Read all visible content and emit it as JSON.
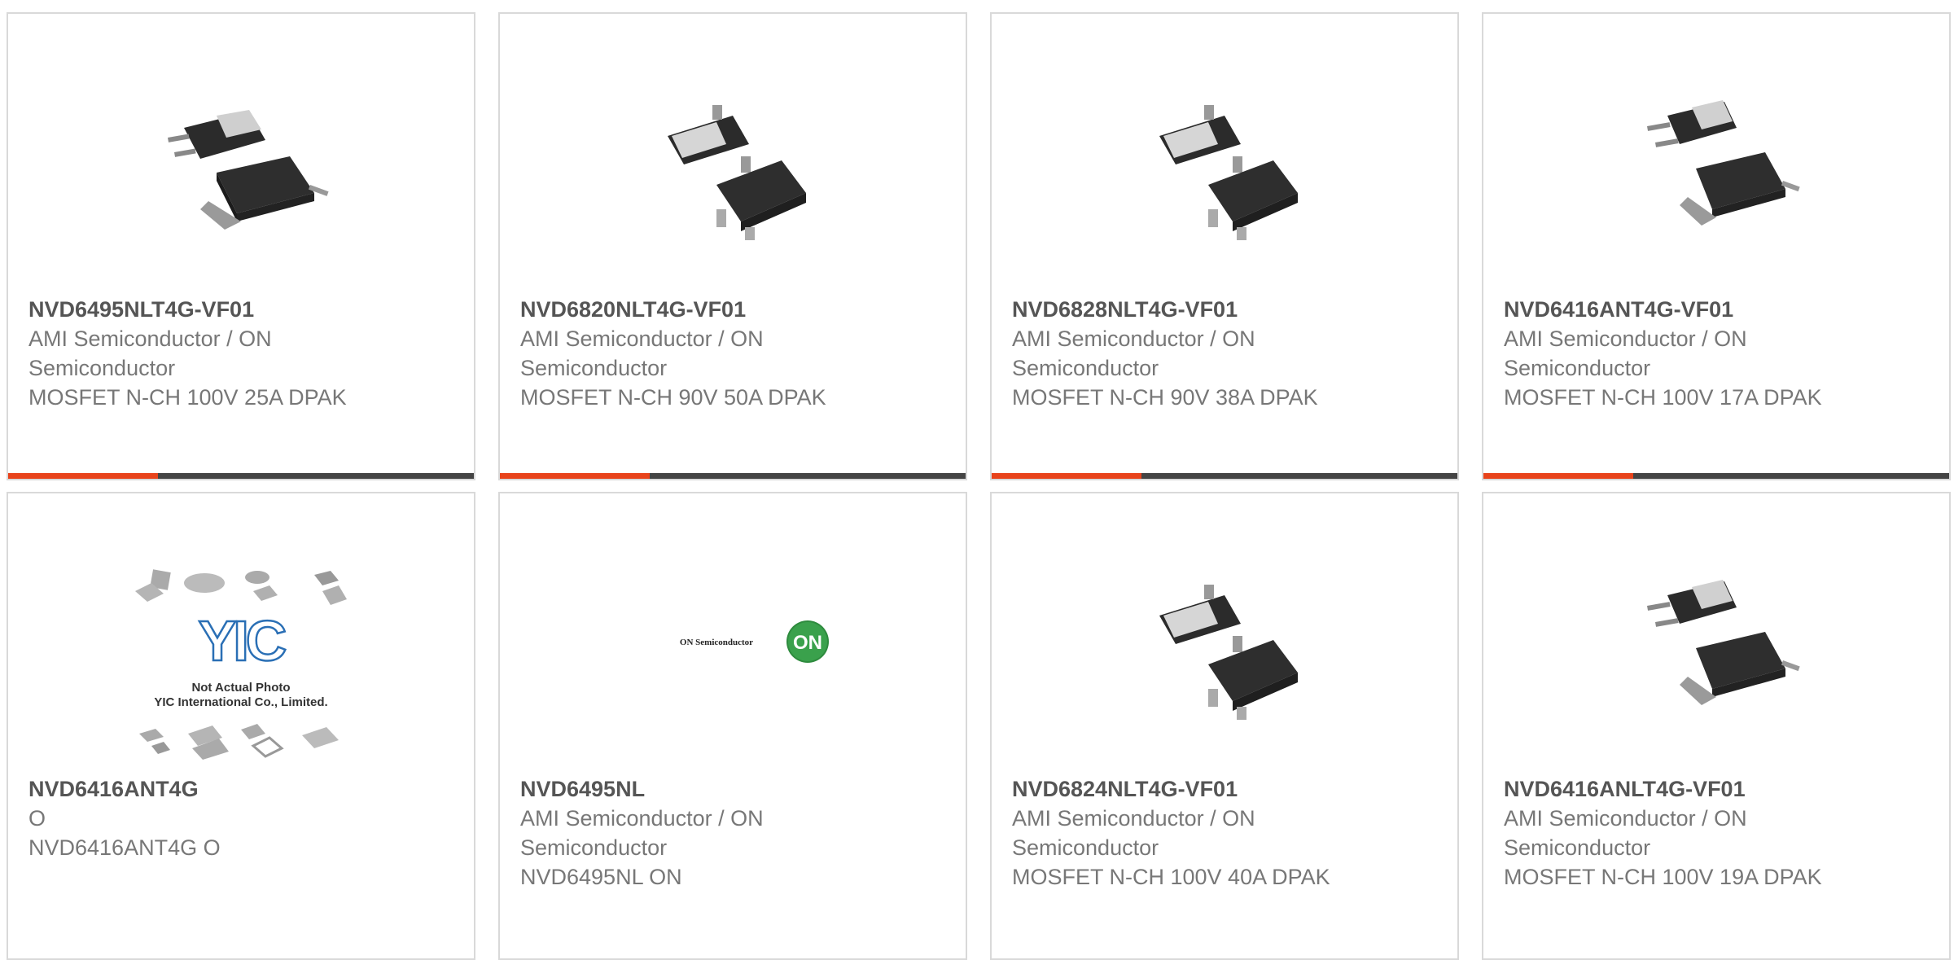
{
  "colors": {
    "accent": "#e8431b",
    "bar_dark": "#444444",
    "border": "#d9d9d9",
    "part_number": "#555555",
    "text": "#777777"
  },
  "products": [
    {
      "part_number": "NVD6495NLT4G-VF01",
      "manufacturer_line1": "AMI Semiconductor / ON",
      "manufacturer_line2": "Semiconductor",
      "description": "MOSFET N-CH 100V 25A DPAK",
      "image": "dpak-package-photo"
    },
    {
      "part_number": "NVD6820NLT4G-VF01",
      "manufacturer_line1": "AMI Semiconductor / ON",
      "manufacturer_line2": "Semiconductor",
      "description": "MOSFET N-CH 90V 50A DPAK",
      "image": "dpak-package-photo"
    },
    {
      "part_number": "NVD6828NLT4G-VF01",
      "manufacturer_line1": "AMI Semiconductor / ON",
      "manufacturer_line2": "Semiconductor",
      "description": "MOSFET N-CH 90V 38A DPAK",
      "image": "dpak-package-photo"
    },
    {
      "part_number": "NVD6416ANT4G-VF01",
      "manufacturer_line1": "AMI Semiconductor / ON",
      "manufacturer_line2": "Semiconductor",
      "description": "MOSFET N-CH 100V 17A DPAK",
      "image": "dpak-package-photo"
    },
    {
      "part_number": "NVD6416ANT4G",
      "manufacturer_line1": "O",
      "manufacturer_line2": "",
      "description": "NVD6416ANT4G O",
      "image": "placeholder-photo",
      "placeholder_text_1": "Not Actual Photo",
      "placeholder_text_2": "YIC International Co., Limited.",
      "placeholder_logo": "YIC"
    },
    {
      "part_number": "NVD6495NL",
      "manufacturer_line1": "AMI Semiconductor / ON",
      "manufacturer_line2": "Semiconductor",
      "description": "NVD6495NL ON",
      "image": "on-semiconductor-logo",
      "logo_text": "ON Semiconductor",
      "logo_badge": "ON"
    },
    {
      "part_number": "NVD6824NLT4G-VF01",
      "manufacturer_line1": "AMI Semiconductor / ON",
      "manufacturer_line2": "Semiconductor",
      "description": "MOSFET N-CH 100V 40A DPAK",
      "image": "dpak-package-photo"
    },
    {
      "part_number": "NVD6416ANLT4G-VF01",
      "manufacturer_line1": "AMI Semiconductor / ON",
      "manufacturer_line2": "Semiconductor",
      "description": "MOSFET N-CH 100V 19A DPAK",
      "image": "dpak-package-photo"
    }
  ]
}
